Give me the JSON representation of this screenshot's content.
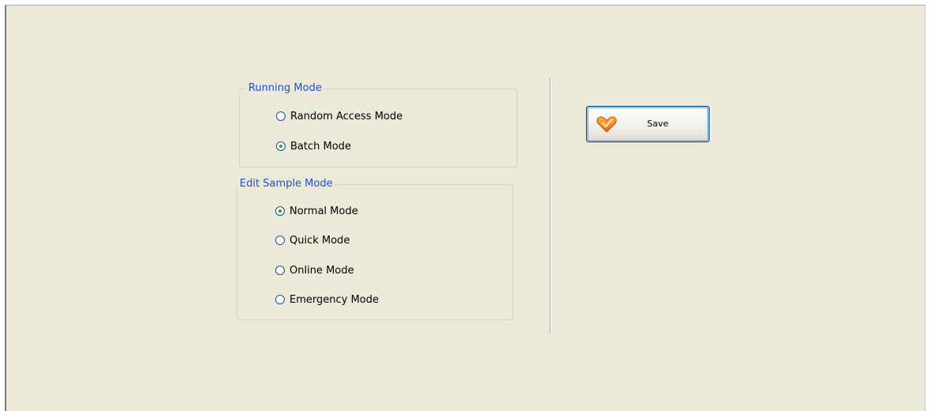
{
  "running_mode": {
    "title": "Running Mode",
    "options": [
      {
        "label": "Random Access Mode",
        "checked": false
      },
      {
        "label": "Batch Mode",
        "checked": true
      }
    ]
  },
  "edit_sample_mode": {
    "title": "Edit Sample Mode",
    "options": [
      {
        "label": "Normal Mode",
        "checked": true
      },
      {
        "label": "Quick Mode",
        "checked": false
      },
      {
        "label": "Online Mode",
        "checked": false
      },
      {
        "label": "Emergency Mode",
        "checked": false
      }
    ]
  },
  "toolbar": {
    "save_label": "Save",
    "save_icon": "heart-check-icon"
  },
  "colors": {
    "window_bg": "#ece9d8",
    "group_title": "#1f4fd0",
    "radio_checked": "#21a121",
    "button_border": "#003c74"
  }
}
